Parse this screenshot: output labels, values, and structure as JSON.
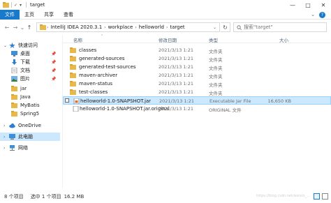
{
  "window": {
    "title": "target",
    "quick_access": [
      "✓",
      "▾"
    ],
    "controls": [
      "—",
      "□",
      "✕"
    ]
  },
  "ribbon": {
    "tabs": [
      "文件",
      "主页",
      "共享",
      "查看"
    ],
    "right": [
      "⌄"
    ],
    "help": "?"
  },
  "nav": {
    "back": "←",
    "forward": "→",
    "recent": "⌄",
    "up": "↑",
    "breadcrumb": [
      "IntelliJ IDEA 2020.3.1",
      "workplace",
      "helloworld",
      "target"
    ],
    "refresh": "↻",
    "search_placeholder": "搜索\"target\""
  },
  "sidebar": {
    "items": [
      {
        "label": "快速访问",
        "icon": "star-icon"
      },
      {
        "label": "桌面",
        "icon": "desktop-icon"
      },
      {
        "label": "下载",
        "icon": "download-icon"
      },
      {
        "label": "文档",
        "icon": "document-icon"
      },
      {
        "label": "图片",
        "icon": "picture-icon"
      },
      {
        "label": "jar",
        "icon": "folder-icon"
      },
      {
        "label": "Java",
        "icon": "folder-icon"
      },
      {
        "label": "MyBatis",
        "icon": "folder-icon"
      },
      {
        "label": "Spring5",
        "icon": "folder-icon"
      },
      {
        "label": "OneDrive",
        "icon": "cloud-icon"
      },
      {
        "label": "此电脑",
        "icon": "computer-icon"
      },
      {
        "label": "网络",
        "icon": "network-icon"
      }
    ]
  },
  "columns": {
    "name": "名称",
    "date": "修改日期",
    "type": "类型",
    "size": "大小"
  },
  "files": [
    {
      "name": "classes",
      "date": "2021/3/13 1:21",
      "type": "文件夹",
      "size": "",
      "icon": "folder-icon"
    },
    {
      "name": "generated-sources",
      "date": "2021/3/13 1:21",
      "type": "文件夹",
      "size": "",
      "icon": "folder-icon"
    },
    {
      "name": "generated-test-sources",
      "date": "2021/3/13 1:21",
      "type": "文件夹",
      "size": "",
      "icon": "folder-icon"
    },
    {
      "name": "maven-archiver",
      "date": "2021/3/13 1:21",
      "type": "文件夹",
      "size": "",
      "icon": "folder-icon"
    },
    {
      "name": "maven-status",
      "date": "2021/3/13 1:21",
      "type": "文件夹",
      "size": "",
      "icon": "folder-icon"
    },
    {
      "name": "test-classes",
      "date": "2021/3/13 1:21",
      "type": "文件夹",
      "size": "",
      "icon": "folder-icon"
    },
    {
      "name": "helloworld-1.0-SNAPSHOT.jar",
      "date": "2021/3/13 1:21",
      "type": "Executable Jar File",
      "size": "16,650 KB",
      "icon": "jar-file-icon"
    },
    {
      "name": "helloworld-1.0-SNAPSHOT.jar.original",
      "date": "2021/3/13 1:21",
      "type": "ORIGINAL 文件",
      "size": "",
      "icon": "file-icon"
    }
  ],
  "status": {
    "count": "8 个项目",
    "selected": "选中 1 个项目",
    "size": "16.2 MB",
    "watermark": "https://blog.csdn.net/weixin_..."
  },
  "colors": {
    "accent": "#1979ca",
    "folder": "#e8b94a",
    "selection": "#cce8ff"
  }
}
